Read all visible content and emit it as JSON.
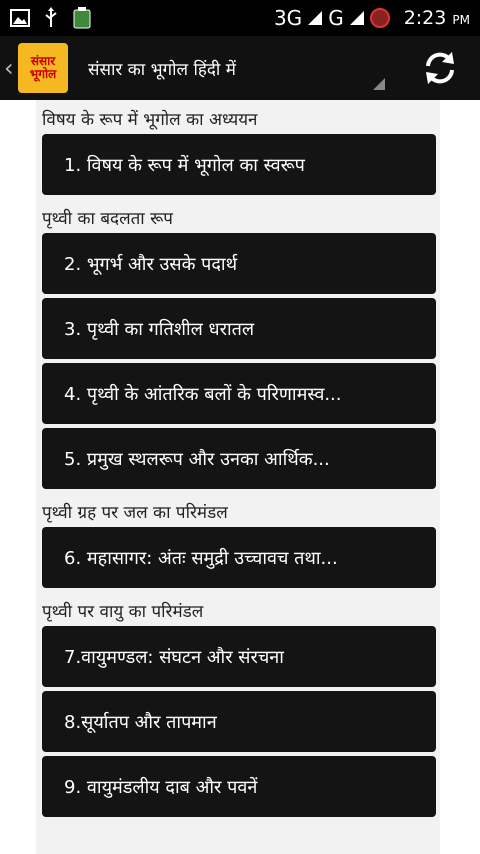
{
  "statusbar": {
    "network_3g": "3G",
    "network_g": "G",
    "alarm_badge": "4",
    "time": "2:23",
    "ampm": "PM"
  },
  "actionbar": {
    "logo_line1": "संसार",
    "logo_line2": "भूगोल",
    "title": "संसार का भूगोल हिंदी में"
  },
  "sections": [
    {
      "header": "विषय के रूप में भूगोल का अध्ययन",
      "items": [
        "1. विषय के रूप में भूगोल का स्वरूप"
      ]
    },
    {
      "header": "पृथ्वी का बदलता रूप",
      "items": [
        "2. भूगर्भ और उसके पदार्थ",
        "3. पृथ्वी का गतिशील धरातल",
        "4. पृथ्वी के आंतरिक बलों के परिणामस्व...",
        "5. प्रमुख स्थलरूप और उनका आर्थिक..."
      ]
    },
    {
      "header": "पृथ्वी ग्रह पर जल का परिमंडल",
      "items": [
        "6. महासागर: अंतः समुद्री उच्चावच तथा..."
      ]
    },
    {
      "header": "पृथ्वी पर वायु का परिमंडल",
      "items": [
        "7.वायुमण्डल: संघटन और संरचना",
        "8.सूर्यातप और तापमान",
        "9. वायुमंडलीय दाब और पवनें"
      ]
    }
  ]
}
